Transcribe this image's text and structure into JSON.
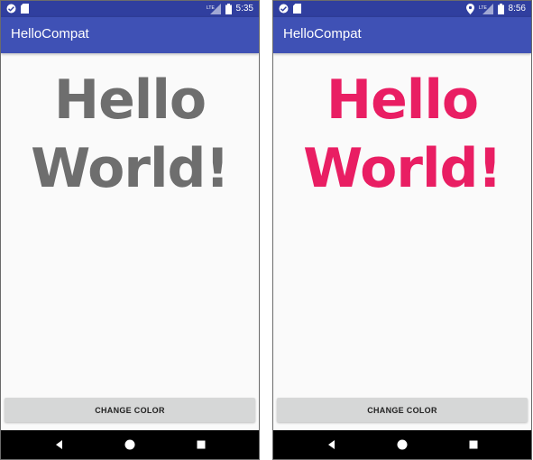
{
  "colors": {
    "status_bar": "#303f9f",
    "app_bar": "#3f51b5",
    "background": "#fafafa",
    "button": "#d6d7d7",
    "nav_bar": "#000000",
    "hello_gray": "#6e6e6e",
    "hello_pink": "#e91e63"
  },
  "screens": [
    {
      "status": {
        "time": "5:35",
        "network": "LTE"
      },
      "app_title": "HelloCompat",
      "hello_line1": "Hello",
      "hello_line2": "World!",
      "hello_color": "#6e6e6e",
      "button_label": "CHANGE COLOR",
      "icons": [
        "notification-icon",
        "sd-card-icon",
        "lte-signal-icon",
        "battery-icon"
      ]
    },
    {
      "status": {
        "time": "8:56",
        "network": "LTE"
      },
      "app_title": "HelloCompat",
      "hello_line1": "Hello",
      "hello_line2": "World!",
      "hello_color": "#e91e63",
      "button_label": "CHANGE COLOR",
      "icons": [
        "notification-icon",
        "sd-card-icon",
        "location-icon",
        "lte-signal-icon",
        "battery-icon"
      ]
    }
  ],
  "nav_icons": [
    "back-icon",
    "home-icon",
    "recents-icon"
  ]
}
